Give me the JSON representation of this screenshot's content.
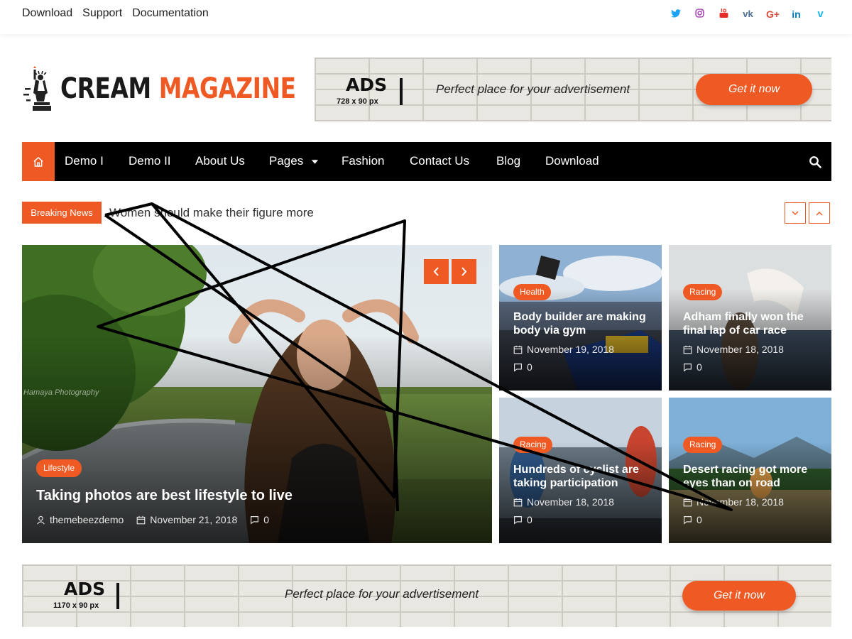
{
  "topbar": {
    "links": [
      "Download",
      "Support",
      "Documentation"
    ],
    "social_icons": [
      {
        "name": "twitter-icon",
        "glyph": "t",
        "color": "#1da1f2"
      },
      {
        "name": "instagram-icon",
        "glyph": "◎",
        "color": "#a43ab5"
      },
      {
        "name": "youtube-icon",
        "glyph": "▶",
        "color": "#e52d27"
      },
      {
        "name": "vk-icon",
        "glyph": "vk",
        "color": "#4c6c91"
      },
      {
        "name": "google-plus-icon",
        "glyph": "G+",
        "color": "#dd4b39"
      },
      {
        "name": "linkedin-icon",
        "glyph": "in",
        "color": "#0077b5"
      },
      {
        "name": "vimeo-icon",
        "glyph": "v",
        "color": "#1ab7ea"
      }
    ]
  },
  "logo": {
    "part1": "CREAM",
    "part2": "MAGAZINE"
  },
  "ad_top": {
    "title": "ADS",
    "size": "728 x 90 px",
    "tagline": "Perfect place for your advertisement",
    "button": "Get it now"
  },
  "ad_bottom": {
    "title": "ADS",
    "size": "1170 x 90 px",
    "tagline": "Perfect place for your advertisement",
    "button": "Get it now"
  },
  "nav": {
    "items": [
      "Demo I",
      "Demo II",
      "About Us",
      "Pages",
      "Fashion",
      "Contact Us",
      "Blog",
      "Download"
    ]
  },
  "breaking": {
    "label": "Breaking News",
    "text": "Women should make their figure more"
  },
  "featured": {
    "category": "Lifestyle",
    "title": "Taking photos are best lifestyle to live",
    "author": "themebeezdemo",
    "date": "November 21, 2018",
    "comments": "0",
    "watermark": "Hamaya Photography"
  },
  "cards": [
    {
      "category": "Health",
      "title": "Body builder are making body via gym",
      "date": "November 19, 2018",
      "comments": "0"
    },
    {
      "category": "Racing",
      "title": "Adham finally won the final lap of car race",
      "date": "November 18, 2018",
      "comments": "0"
    },
    {
      "category": "Racing",
      "title": "Hundreds of cyclist are taking participation",
      "date": "November 18, 2018",
      "comments": "0"
    },
    {
      "category": "Racing",
      "title": "Desert racing got more eyes than on road",
      "date": "November 18, 2018",
      "comments": "0"
    }
  ],
  "colors": {
    "accent": "#ef5a24",
    "nav_bg": "#000000"
  }
}
